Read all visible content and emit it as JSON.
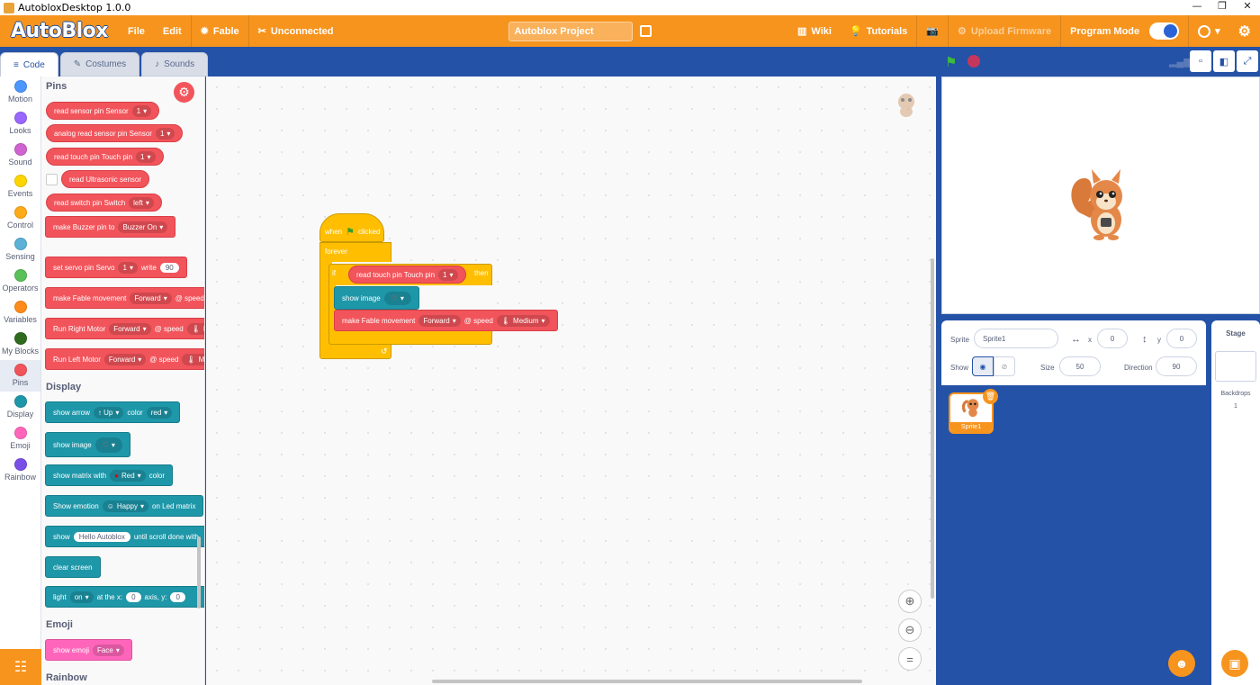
{
  "window": {
    "title": "AutobloxDesktop 1.0.0",
    "minimize": "—",
    "maximize": "❐",
    "close": "✕"
  },
  "menubar": {
    "logo": "AutoBlox",
    "file": "File",
    "edit": "Edit",
    "device": "Fable",
    "connection": "Unconnected",
    "project_title": "Autoblox Project",
    "wiki": "Wiki",
    "tutorials": "Tutorials",
    "upload_firmware": "Upload Firmware",
    "program_mode": "Program Mode"
  },
  "tabs": {
    "code": "Code",
    "costumes": "Costumes",
    "sounds": "Sounds"
  },
  "categories": [
    {
      "label": "Motion",
      "color": "#4c97ff"
    },
    {
      "label": "Looks",
      "color": "#9966ff"
    },
    {
      "label": "Sound",
      "color": "#cf63cf"
    },
    {
      "label": "Events",
      "color": "#ffd500"
    },
    {
      "label": "Control",
      "color": "#ffab19"
    },
    {
      "label": "Sensing",
      "color": "#5cb1d6"
    },
    {
      "label": "Operators",
      "color": "#59c059"
    },
    {
      "label": "Variables",
      "color": "#ff8c1a"
    },
    {
      "label": "My Blocks",
      "color": "#2e6b1f"
    },
    {
      "label": "Pins",
      "color": "#f2545b"
    },
    {
      "label": "Display",
      "color": "#1e97a9"
    },
    {
      "label": "Emoji",
      "color": "#ff66bb"
    },
    {
      "label": "Rainbow",
      "color": "#7a4fe8"
    }
  ],
  "palette": {
    "pins_title": "Pins",
    "display_title": "Display",
    "emoji_title": "Emoji",
    "rainbow_title": "Rainbow",
    "read_sensor": {
      "text": "read sensor pin Sensor",
      "value": "1"
    },
    "analog_read": {
      "text": "analog read sensor pin Sensor",
      "value": "1"
    },
    "read_touch": {
      "text": "read touch pin Touch pin",
      "value": "1"
    },
    "read_ultrasonic": "read Ultrasonic sensor",
    "read_switch": {
      "text": "read switch pin Switch",
      "value": "left"
    },
    "buzzer": {
      "text": "make Buzzer pin to",
      "value": "Buzzer On"
    },
    "servo": {
      "text": "set servo pin Servo",
      "value": "1",
      "write": "write",
      "angle": "90"
    },
    "fable_move": {
      "text": "make Fable movement",
      "value": "Forward",
      "speed": "@ speed"
    },
    "right_motor": {
      "text": "Run Right Motor",
      "value": "Forward",
      "speed": "@ speed",
      "level": "M"
    },
    "left_motor": {
      "text": "Run Left Motor",
      "value": "Forward",
      "speed": "@ speed",
      "level": "Me"
    },
    "show_arrow": {
      "text": "show arrow",
      "dir": "↑ Up",
      "color_label": "color",
      "color": "red"
    },
    "show_image": "show image",
    "show_matrix": {
      "text": "show matrix with",
      "color": "Red",
      "suffix": "color"
    },
    "show_emotion": {
      "text": "Show emotion",
      "value": "Happy",
      "suffix": "on Led matrix"
    },
    "show_text": {
      "text": "show",
      "value": "Hello Autoblox",
      "suffix": "until scroll done with"
    },
    "clear_screen": "clear screen",
    "light": {
      "text": "light",
      "value": "on",
      "at_x": "at the x:",
      "x": "0",
      "axis_y": "axis, y:",
      "y": "0"
    },
    "show_emoji": {
      "text": "show emoji",
      "value": "Face"
    }
  },
  "script": {
    "when": "when",
    "clicked": "clicked",
    "forever": "forever",
    "if": "if",
    "then": "then",
    "read_touch": "read touch pin Touch pin",
    "touch_value": "1",
    "show_image": "show image",
    "fable_move": "make Fable movement",
    "direction": "Forward",
    "speed": "@ speed",
    "speed_value": "Medium"
  },
  "sprite": {
    "sprite_label": "Sprite",
    "name": "Sprite1",
    "x_label": "x",
    "x": "0",
    "y_label": "y",
    "y": "0",
    "show_label": "Show",
    "size_label": "Size",
    "size": "50",
    "direction_label": "Direction",
    "direction": "90",
    "card_name": "Sprite1"
  },
  "stage_panel": {
    "title": "Stage",
    "backdrops_label": "Backdrops",
    "backdrops_count": "1"
  },
  "colors": {
    "brand": "#f7941d",
    "main_bg": "#2452a7",
    "pins": "#f2545b",
    "display": "#1e97a9",
    "control": "#ffbf00"
  }
}
